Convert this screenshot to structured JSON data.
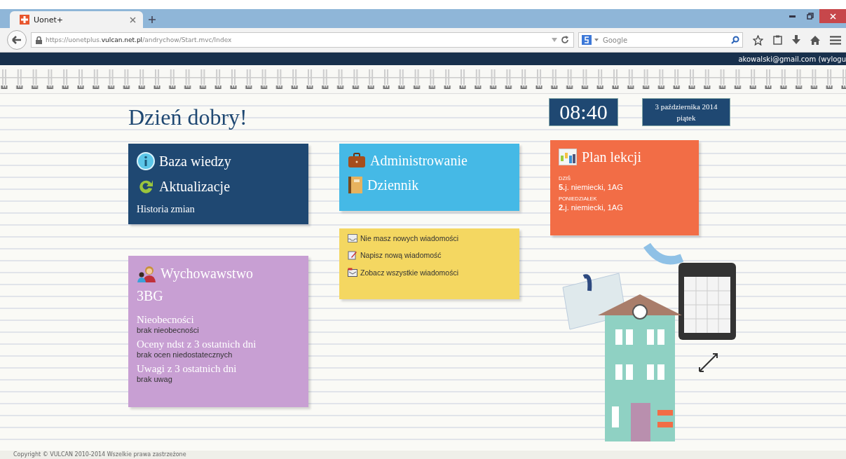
{
  "browser": {
    "tab_title": "Uonet+",
    "url": "https://uonetplus.**vulcan.net.pl**/andrychow/Start.mvc/Index",
    "search_placeholder": "Google"
  },
  "header": {
    "user": "akowalski@gmail.com (wylogu"
  },
  "greeting": "Dzień dobry!",
  "clock": {
    "time": "08:40",
    "date": "3 października 2014",
    "weekday": "piątek"
  },
  "knowledge_tile": {
    "links": [
      {
        "label": "Baza wiedzy",
        "kind": "info"
      },
      {
        "label": "Aktualizacje",
        "kind": "refresh"
      }
    ],
    "footer_link": "Historia zmian"
  },
  "admin_tile": {
    "links": [
      {
        "label": "Administrowanie",
        "kind": "briefcase"
      },
      {
        "label": "Dziennik",
        "kind": "book"
      }
    ]
  },
  "schedule_tile": {
    "title": "Plan lekcji",
    "entries": [
      {
        "day": "DZIŚ",
        "lesson_number": "5.",
        "subject": "j. niemiecki, 1AG"
      },
      {
        "day": "PONIEDZIAŁEK",
        "lesson_number": "2.",
        "subject": "j. niemiecki, 1AG"
      }
    ]
  },
  "messages_tile": {
    "items": [
      {
        "label": "Nie masz nowych wiadomości",
        "kind": "inbox"
      },
      {
        "label": "Napisz nową wiadomość",
        "kind": "compose"
      },
      {
        "label": "Zobacz wszystkie wiadomości",
        "kind": "folder"
      }
    ]
  },
  "homeroom_tile": {
    "title": "Wychowawstwo",
    "class_name": "3BG",
    "sections": [
      {
        "heading": "Nieobecności",
        "value": "brak nieobecności"
      },
      {
        "heading": "Oceny ndst z 3 ostatnich dni",
        "value": "brak ocen niedostatecznych"
      },
      {
        "heading": "Uwagi z 3 ostatnich dni",
        "value": "brak uwag"
      }
    ]
  },
  "footer": "Copyright © VULCAN 2010-2014 Wszelkie prawa zastrzeżone"
}
